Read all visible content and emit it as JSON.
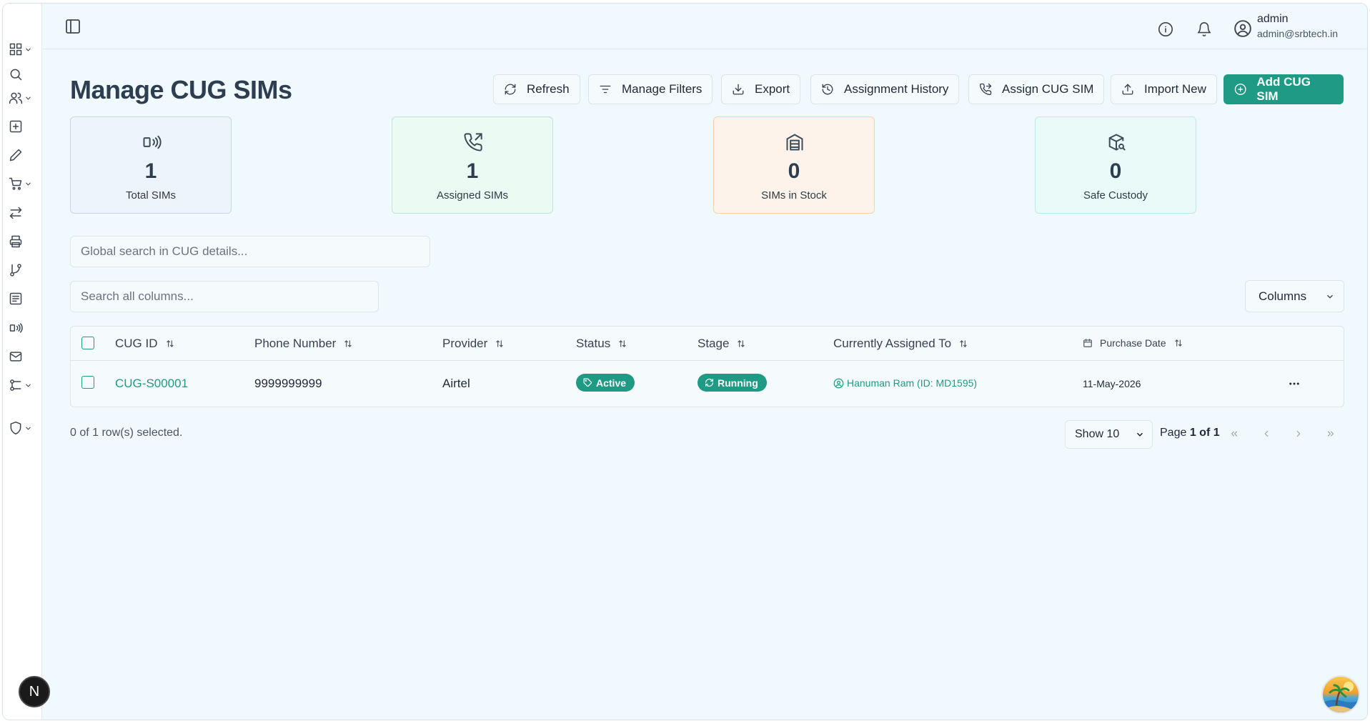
{
  "user": {
    "name": "admin",
    "email": "admin@srbtech.in"
  },
  "page": {
    "title": "Manage CUG SIMs"
  },
  "toolbar": {
    "refresh": "Refresh",
    "manage_filters": "Manage Filters",
    "export": "Export",
    "assignment_history": "Assignment History",
    "assign_cug_sim": "Assign CUG SIM",
    "import_new": "Import New",
    "add_cug_sim": "Add CUG SIM"
  },
  "stats": [
    {
      "value": "1",
      "label": "Total SIMs",
      "bg": "#eef4fb",
      "border": "#c9d6e6",
      "icon": "sim-signal-icon"
    },
    {
      "value": "1",
      "label": "Assigned SIMs",
      "bg": "#ebfaf3",
      "border": "#bfe7d3",
      "icon": "phone-outgoing-icon"
    },
    {
      "value": "0",
      "label": "SIMs in Stock",
      "bg": "#fdf3ea",
      "border": "#f2d3b3",
      "icon": "warehouse-icon"
    },
    {
      "value": "0",
      "label": "Safe Custody",
      "bg": "#eafaf9",
      "border": "#b9ebe6",
      "icon": "package-search-icon"
    }
  ],
  "search": {
    "global_placeholder": "Global search in CUG details...",
    "columns_placeholder": "Search all columns..."
  },
  "columns_button": "Columns",
  "table": {
    "headers": {
      "cug_id": "CUG ID",
      "phone": "Phone Number",
      "provider": "Provider",
      "status": "Status",
      "stage": "Stage",
      "assigned_to": "Currently Assigned To",
      "purchase_date": "Purchase Date"
    },
    "rows": [
      {
        "cug_id": "CUG-S00001",
        "phone": "9999999999",
        "provider": "Airtel",
        "status": "Active",
        "stage": "Running",
        "assigned_to": "Hanuman Ram (ID: MD1595)",
        "purchase_date": "11-May-2026"
      }
    ]
  },
  "footer": {
    "selection": "0 of 1 row(s) selected.",
    "page_size": "Show 10",
    "page_label": "Page",
    "page_current": "1 of 1"
  },
  "dev_badge": "N",
  "colors": {
    "accent": "#1f9a84",
    "title": "#2c3e50",
    "background": "#f0f9fd"
  }
}
